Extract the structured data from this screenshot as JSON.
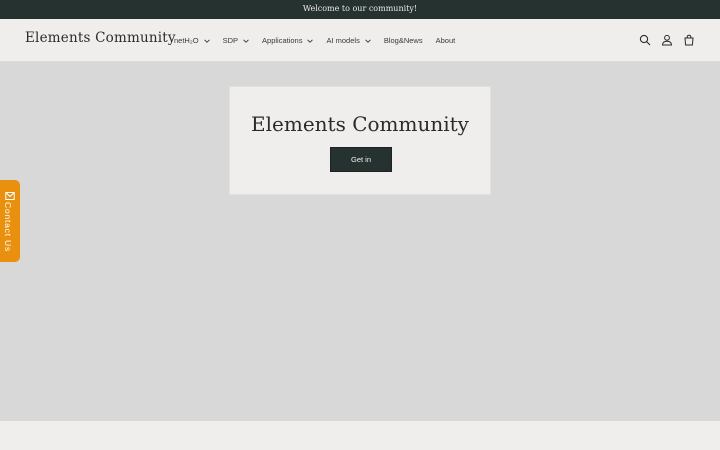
{
  "announcement": {
    "text": "Welcome to our community!"
  },
  "header": {
    "logo": "Elements Community",
    "nav": [
      {
        "label": "netH₂O",
        "has_dropdown": true
      },
      {
        "label": "SDP",
        "has_dropdown": true
      },
      {
        "label": "Applications",
        "has_dropdown": true
      },
      {
        "label": "AI models",
        "has_dropdown": true
      },
      {
        "label": "Blog&News",
        "has_dropdown": false
      },
      {
        "label": "About",
        "has_dropdown": false
      }
    ],
    "icons": [
      "search-icon",
      "account-icon",
      "cart-icon"
    ]
  },
  "hero": {
    "title": "Elements Community",
    "button_label": "Get in"
  },
  "contact_tab": {
    "label": "Contact Us",
    "icon": "mail-icon"
  },
  "colors": {
    "announcement_bg": "#263230",
    "header_bg": "#efeeec",
    "page_bg": "#d9d8d8",
    "button_bg": "#263230",
    "contact_accent": "#e9900f"
  }
}
